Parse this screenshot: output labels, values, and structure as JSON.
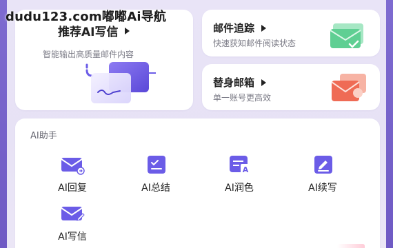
{
  "watermark": "dudu123.com嘟嘟Ai导航",
  "cards": {
    "write": {
      "title": "推荐AI写信",
      "subtitle": "智能输出高质量邮件内容"
    },
    "track": {
      "title": "邮件追踪",
      "subtitle": "快速获知邮件阅读状态"
    },
    "alias": {
      "title": "替身邮箱",
      "subtitle": "单一账号更高效"
    }
  },
  "assistant": {
    "title": "AI助手",
    "tools": [
      {
        "label": "AI回复",
        "icon": "envelope-reply-icon"
      },
      {
        "label": "AI总结",
        "icon": "checklist-icon"
      },
      {
        "label": "AI润色",
        "icon": "text-format-icon"
      },
      {
        "label": "AI续写",
        "icon": "pen-write-icon"
      },
      {
        "label": "AI写信",
        "icon": "envelope-pen-icon"
      }
    ]
  },
  "colors": {
    "accent": "#6b5ce7",
    "background": "#e9e4f7",
    "side_strip": "#7e6bd0",
    "card": "#ffffff"
  }
}
